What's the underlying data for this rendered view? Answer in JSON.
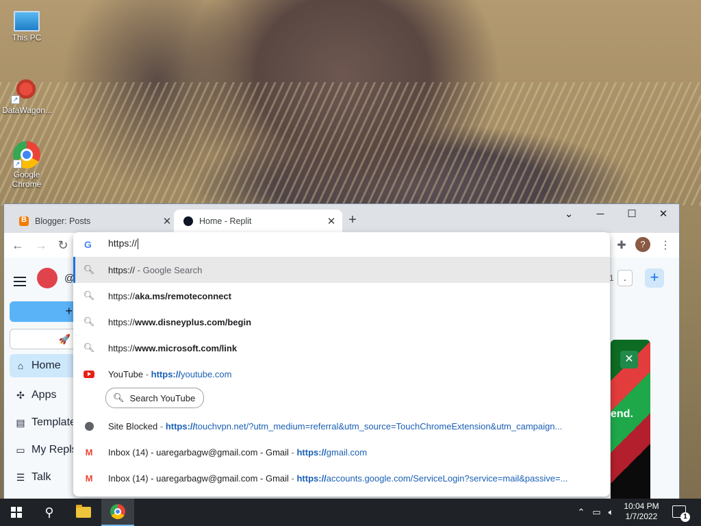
{
  "desktop": {
    "icons": [
      {
        "label": "This PC",
        "icon": "computer-icon"
      },
      {
        "label": "DataWagon...",
        "icon": "datawagon-icon"
      },
      {
        "label": "Google Chrome",
        "icon": "chrome-icon"
      }
    ]
  },
  "browser": {
    "tabs": [
      {
        "title": "Blogger: Posts",
        "favicon": "blogger-icon",
        "active": false
      },
      {
        "title": "Home - Replit",
        "favicon": "replit-icon",
        "active": true
      }
    ],
    "omnibox": {
      "value": "https://",
      "suggestions": [
        {
          "type": "search",
          "icon": "search-icon",
          "primary": "https://",
          "secondary": " - Google Search",
          "selected": true
        },
        {
          "type": "history",
          "icon": "search-icon",
          "prefix": "https://",
          "bold": "aka.ms/remoteconnect"
        },
        {
          "type": "history",
          "icon": "search-icon",
          "prefix": "https://",
          "bold": "www.disneyplus.com/begin"
        },
        {
          "type": "history",
          "icon": "search-icon",
          "prefix": "https://",
          "bold": "www.microsoft.com/link"
        },
        {
          "type": "site",
          "icon": "youtube-icon",
          "title": "YouTube",
          "sep": " - ",
          "url_bold": "https://",
          "url_rest": "youtube.com"
        },
        {
          "type": "site",
          "icon": "globe-icon",
          "title": "Site Blocked",
          "sep": " - ",
          "url_bold": "https://",
          "url_rest": "touchvpn.net/?utm_medium=referral&utm_source=TouchChromeExtension&utm_campaign..."
        },
        {
          "type": "site",
          "icon": "gmail-icon",
          "title": "Inbox (14) - uaregarbagw@gmail.com - Gmail",
          "sep": " - ",
          "url_bold": "https://",
          "url_rest": "gmail.com"
        },
        {
          "type": "site",
          "icon": "gmail-icon",
          "title": "Inbox (14) - uaregarbagw@gmail.com - Gmail",
          "sep": " - ",
          "url_bold": "https://",
          "url_rest": "accounts.google.com/ServiceLogin?service=mail&passive=..."
        }
      ],
      "youtube_search_button": "Search YouTube"
    },
    "profile_initial": "?"
  },
  "replit": {
    "user_prefix": "@",
    "sidebar": [
      {
        "label": "Home",
        "icon": "home-icon",
        "active": true
      },
      {
        "label": "Apps",
        "icon": "apps-icon",
        "active": false
      },
      {
        "label": "Template",
        "icon": "template-icon",
        "active": false
      },
      {
        "label": "My Repls",
        "icon": "folder-icon",
        "active": false
      },
      {
        "label": "Talk",
        "icon": "talk-icon",
        "active": false
      }
    ],
    "top_right_count": "1",
    "banner_text": "end."
  },
  "taskbar": {
    "time": "10:04 PM",
    "date": "1/7/2022",
    "notification_count": "1"
  },
  "colors": {
    "accent_blue": "#1a73e8",
    "link_blue": "#1a5fb4",
    "replit_create": "#5ab3f7",
    "taskbar": "#1f2327"
  }
}
